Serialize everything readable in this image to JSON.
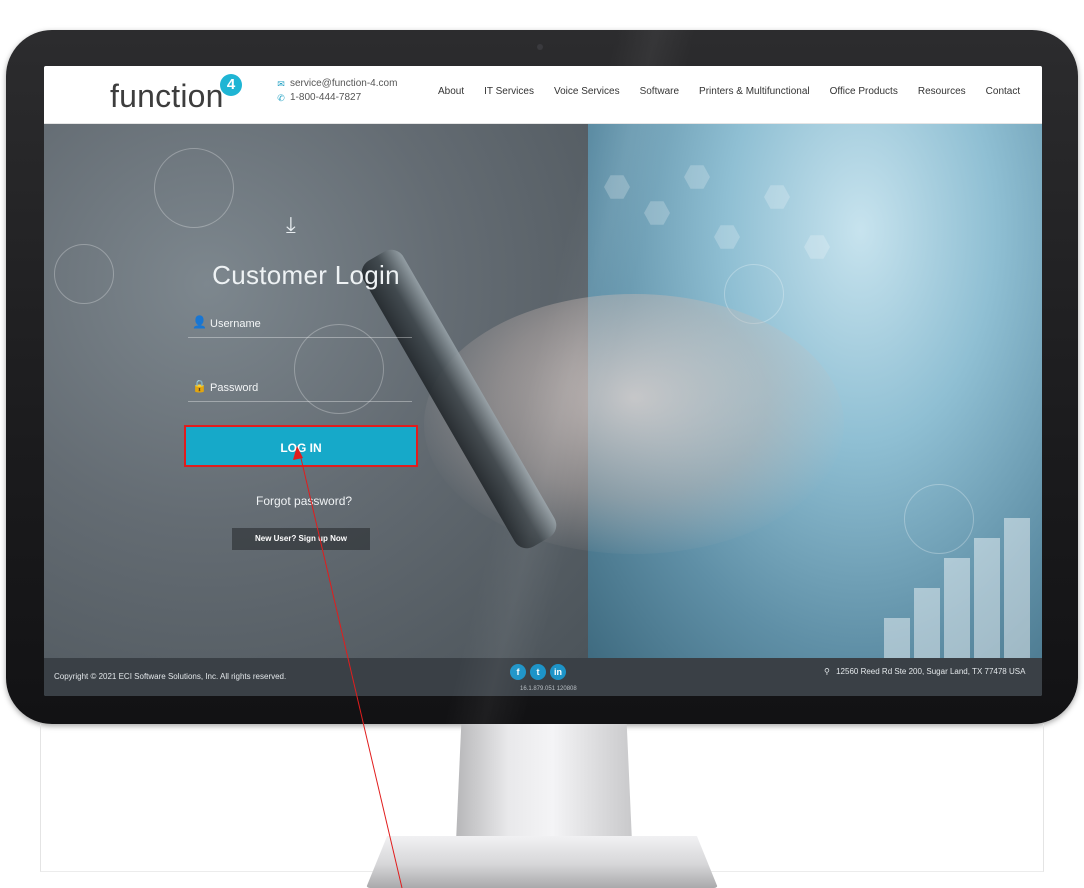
{
  "site": {
    "logo_text": "function",
    "logo_badge": "4",
    "email": "service@function-4.com",
    "phone": "1-800-444-7827"
  },
  "nav": {
    "items": [
      "About",
      "IT Services",
      "Voice Services",
      "Software",
      "Printers & Multifunctional",
      "Office Products",
      "Resources",
      "Contact"
    ]
  },
  "login": {
    "title": "Customer Login",
    "username_placeholder": "Username",
    "password_placeholder": "Password",
    "login_button": "LOG IN",
    "forgot_link": "Forgot password?",
    "signup_button": "New User? Sign up Now"
  },
  "footer": {
    "copyright": "Copyright © 2021 ECI Software Solutions, Inc. All rights reserved.",
    "social": [
      "f",
      "t",
      "in"
    ],
    "version": "16.1.879.051 120808",
    "address": "12560 Reed Rd Ste 200, Sugar Land, TX 77478 USA"
  },
  "colors": {
    "accent": "#16a9c9",
    "highlight": "#e11d1d"
  }
}
